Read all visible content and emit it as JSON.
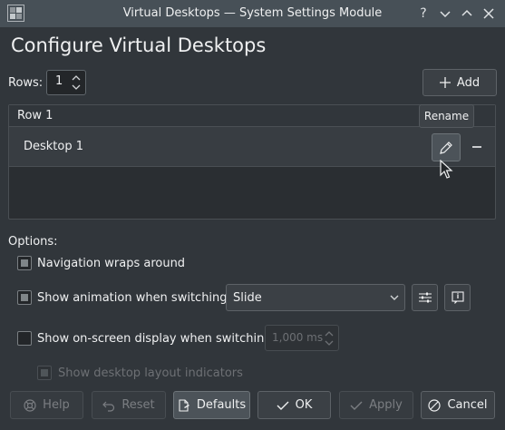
{
  "window": {
    "title": "Virtual Desktops — System Settings Module",
    "buttons": [
      "help-icon",
      "minimize-icon",
      "maximize-icon",
      "close-icon"
    ]
  },
  "heading": "Configure Virtual Desktops",
  "rows": {
    "label": "Rows:",
    "value": "1"
  },
  "add_button": "Add",
  "desktops": {
    "header": "Row 1",
    "items": [
      {
        "name": "Desktop 1"
      }
    ],
    "tooltip": "Rename"
  },
  "options": {
    "title": "Options:",
    "nav_wraps": {
      "label": "Navigation wraps around",
      "checked": "partial"
    },
    "animation": {
      "label": "Show animation when switching:",
      "checked": "partial",
      "selected": "Slide"
    },
    "osd": {
      "label": "Show on-screen display when switching:",
      "checked": false,
      "duration": "1,000 ms"
    },
    "layout_indicators": {
      "label": "Show desktop layout indicators",
      "enabled": false
    }
  },
  "footer": {
    "help": "Help",
    "reset": "Reset",
    "defaults": "Defaults",
    "ok": "OK",
    "apply": "Apply",
    "cancel": "Cancel"
  },
  "colors": {
    "background": "#31363b",
    "titlebar": "#475057",
    "text": "#eff0f1",
    "disabled_text": "#7b7e82"
  }
}
